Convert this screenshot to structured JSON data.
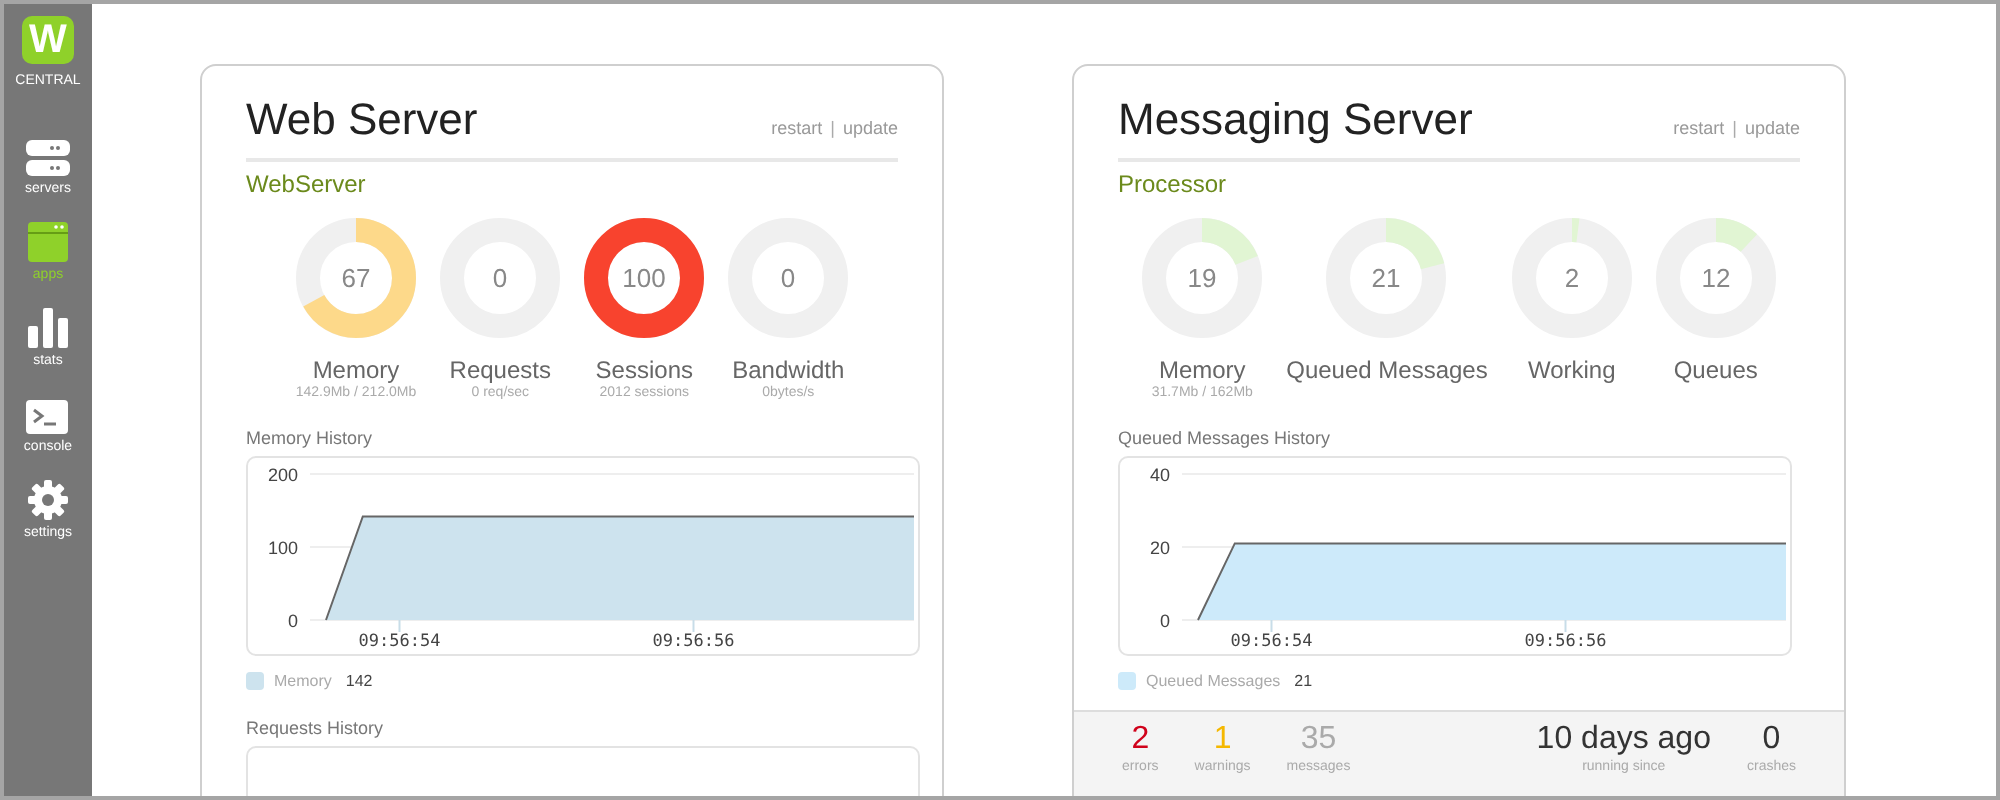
{
  "sidebar": {
    "logo_mark": "W",
    "logo_text": "CENTRAL",
    "items": [
      {
        "kind": "servers",
        "label": "servers",
        "selected": false
      },
      {
        "kind": "apps",
        "label": "apps",
        "selected": true
      },
      {
        "kind": "stats",
        "label": "stats",
        "selected": false
      },
      {
        "kind": "console",
        "label": "console",
        "selected": false
      },
      {
        "kind": "settings",
        "label": "settings",
        "selected": false
      }
    ]
  },
  "cards": [
    {
      "title": "Web Server",
      "actions": [
        "restart",
        "update"
      ],
      "separator": "|",
      "subtitle": "WebServer",
      "gauges": [
        {
          "value": "67",
          "label": "Memory",
          "detail": "142.9Mb / 212.0Mb",
          "level": 0.67,
          "color": "#fdd98a"
        },
        {
          "value": "0",
          "label": "Requests",
          "detail": "0 req/sec",
          "level": 0,
          "color": "#f0f0f0"
        },
        {
          "value": "100",
          "label": "Sessions",
          "detail": "2012 sessions",
          "level": 1,
          "color": "#f8432e"
        },
        {
          "value": "0",
          "label": "Bandwidth",
          "detail": "0bytes/s",
          "level": 0,
          "color": "#f0f0f0"
        }
      ],
      "history": [
        {
          "title": "Memory History",
          "legend": {
            "value": "142"
          },
          "chart_data": {
            "type": "area",
            "categories": [
              null,
              null,
              "09:56:54",
              null,
              null,
              null,
              null,
              null,
              null,
              null,
              "09:56:56",
              null,
              null,
              null,
              null,
              null,
              null
            ],
            "series": [
              {
                "name": "Memory",
                "color": "#cde3ee",
                "values": [
                  0,
                  142,
                  142,
                  142,
                  142,
                  142,
                  142,
                  142,
                  142,
                  142,
                  142,
                  142,
                  142,
                  142,
                  142,
                  142,
                  142
                ]
              }
            ],
            "ylim": [
              0,
              200
            ],
            "yticks": [
              0,
              100,
              200
            ]
          }
        },
        {
          "title": "Requests History"
        }
      ]
    },
    {
      "title": "Messaging Server",
      "actions": [
        "restart",
        "update"
      ],
      "separator": "|",
      "subtitle": "Processor",
      "gauges": [
        {
          "value": "19",
          "label": "Memory",
          "detail": "31.7Mb / 162Mb",
          "level": 0.19,
          "color": "#e1f5d3"
        },
        {
          "value": "21",
          "label": "Queued Messages",
          "level": 0.21,
          "color": "#e1f5d3"
        },
        {
          "value": "2",
          "label": "Working",
          "level": 0.02,
          "color": "#e1f5d3"
        },
        {
          "value": "12",
          "label": "Queues",
          "level": 0.12,
          "color": "#e1f5d3"
        }
      ],
      "history": [
        {
          "title": "Queued Messages History",
          "legend": {
            "value": "21"
          },
          "chart_data": {
            "type": "area",
            "categories": [
              null,
              null,
              "09:56:54",
              null,
              null,
              null,
              null,
              null,
              null,
              null,
              "09:56:56",
              null,
              null,
              null,
              null,
              null,
              null
            ],
            "series": [
              {
                "name": "Queued Messages",
                "color": "#cdeafa",
                "values": [
                  0,
                  21,
                  21,
                  21,
                  21,
                  21,
                  21,
                  21,
                  21,
                  21,
                  21,
                  21,
                  21,
                  21,
                  21,
                  21,
                  21
                ]
              }
            ],
            "ylim": [
              0,
              40
            ],
            "yticks": [
              0,
              20,
              40
            ]
          }
        }
      ],
      "stats": [
        {
          "value": "2",
          "label": "errors",
          "color": "#d0021b"
        },
        {
          "value": "1",
          "label": "warnings",
          "color": "#f5b800"
        },
        {
          "value": "35",
          "label": "messages",
          "color": "#aaaaaa"
        },
        {
          "value": "10 days ago",
          "label": "running since",
          "color": "#333333"
        },
        {
          "value": "0",
          "label": "crashes",
          "color": "#333333"
        }
      ]
    }
  ]
}
